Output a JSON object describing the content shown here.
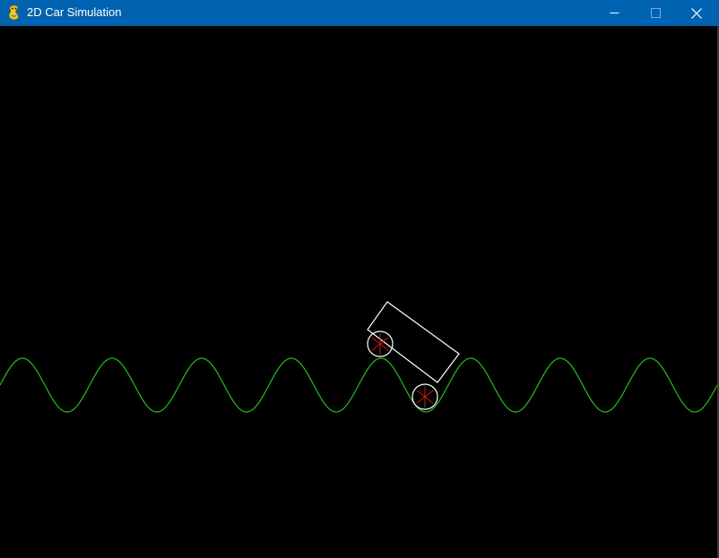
{
  "window": {
    "title": "2D Car Simulation",
    "titlebar_color": "#0063b1",
    "icon": "pygame-snake-icon",
    "controls": {
      "minimize_icon": "minimize-icon",
      "maximize_icon": "maximize-icon",
      "close_icon": "close-icon"
    }
  },
  "simulation": {
    "background_color": "#000000",
    "terrain": {
      "type": "sine-wave",
      "color": "#22c01e"
    },
    "car": {
      "body_color": "#ffffff",
      "wheel_outline_color": "#ffffff",
      "wheel_spoke_color": "#d01818",
      "wheel_count": 2
    }
  }
}
